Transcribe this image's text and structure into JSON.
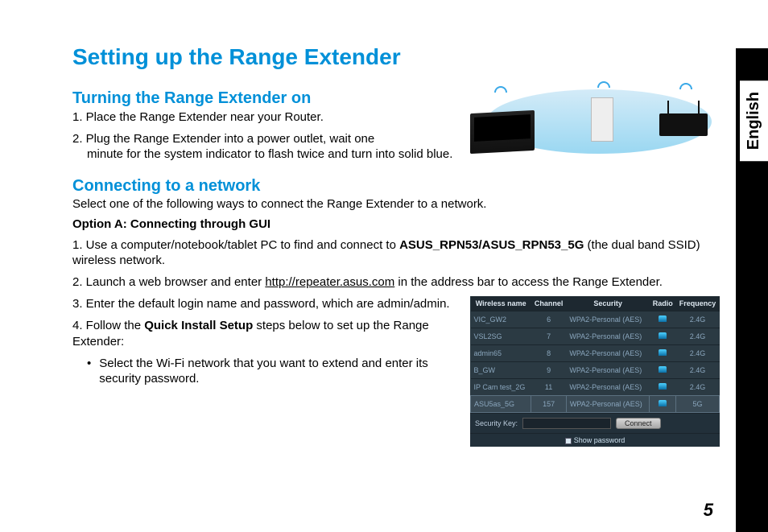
{
  "lang_tab": "English",
  "page_title": "Setting up the Range Extender",
  "section1": {
    "heading": "Turning the Range Extender on",
    "step1": "1. Place the Range Extender near your Router.",
    "step2_a": "2. Plug the Range Extender into a power outlet, wait one",
    "step2_b": "minute for the system indicator to flash twice and turn into solid blue."
  },
  "section2": {
    "heading": "Connecting to a network",
    "intro": "Select one of the following ways to connect the Range Extender to a network.",
    "optionA_hdr": "Option A: Connecting through GUI",
    "step1_a": "1. Use a computer/notebook/tablet PC to find and connect to ",
    "step1_bold": "ASUS_RPN53/ASUS_RPN53_5G",
    "step1_b": " (the dual band SSID) wireless network.",
    "step2_a": "2. Launch a web browser and enter ",
    "step2_link": "http://repeater.asus.com",
    "step2_b": " in the address bar to access the Range Extender.",
    "step3": "3. Enter the default login name and password, which are admin/admin.",
    "step4_a": "4.  Follow the ",
    "step4_bold": "Quick Install Setup",
    "step4_b": " steps below to set up the Range Extender:",
    "bullet1": "Select the Wi-Fi network that you want to extend and enter its security password."
  },
  "wifi_table": {
    "headers": [
      "Wireless name",
      "Channel",
      "Security",
      "Radio",
      "Frequency"
    ],
    "rows": [
      [
        "VIC_GW2",
        "6",
        "WPA2-Personal (AES)",
        "sig",
        "2.4G"
      ],
      [
        "VSL2SG",
        "7",
        "WPA2-Personal (AES)",
        "sig",
        "2.4G"
      ],
      [
        "admin65",
        "8",
        "WPA2-Personal (AES)",
        "sig",
        "2.4G"
      ],
      [
        "B_GW",
        "9",
        "WPA2-Personal (AES)",
        "sig",
        "2.4G"
      ],
      [
        "IP Cam test_2G",
        "11",
        "WPA2-Personal (AES)",
        "sig",
        "2.4G"
      ],
      [
        "ASU5as_5G",
        "157",
        "WPA2-Personal (AES)",
        "sig",
        "5G"
      ]
    ],
    "sec_label": "Security Key:",
    "connect_btn": "Connect",
    "show_pw": "Show password"
  },
  "page_number": "5"
}
